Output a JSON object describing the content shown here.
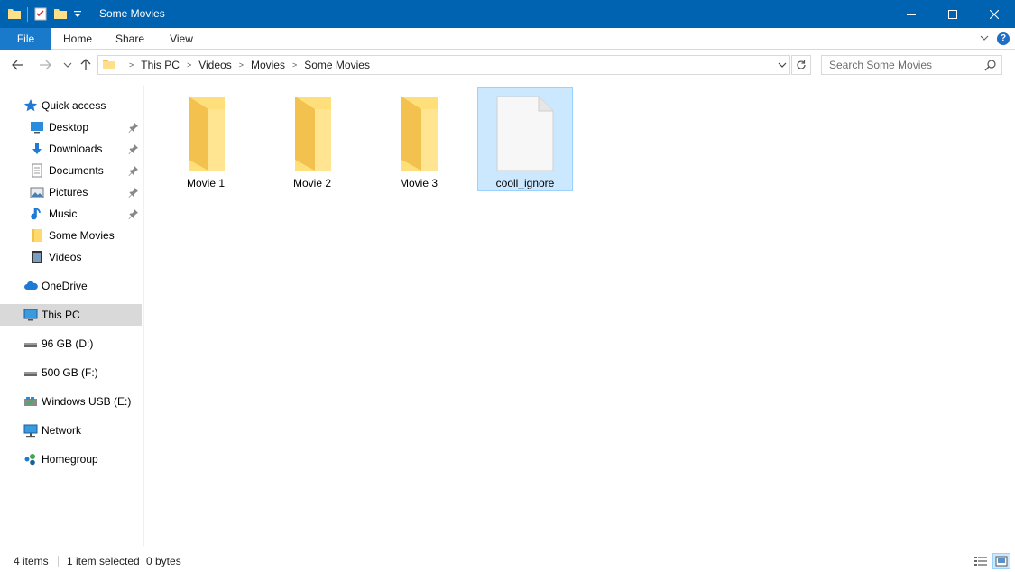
{
  "window": {
    "title": "Some Movies",
    "accent_color": "#0063b1",
    "controls": {
      "minimize": "—",
      "maximize": "☐",
      "close": "✕"
    }
  },
  "ribbon": {
    "tabs": [
      {
        "label": "File"
      },
      {
        "label": "Home"
      },
      {
        "label": "Share"
      },
      {
        "label": "View"
      }
    ],
    "help": "?"
  },
  "address_bar": {
    "crumbs": [
      "This PC",
      "Videos",
      "Movies",
      "Some Movies"
    ]
  },
  "search": {
    "placeholder": "Search Some Movies"
  },
  "navigation_pane": {
    "quick_access": "Quick access",
    "quick_items": [
      {
        "label": "Desktop",
        "icon": "desktop-icon"
      },
      {
        "label": "Downloads",
        "icon": "downloads-icon"
      },
      {
        "label": "Documents",
        "icon": "documents-icon"
      },
      {
        "label": "Pictures",
        "icon": "pictures-icon"
      },
      {
        "label": "Music",
        "icon": "music-icon"
      },
      {
        "label": "Some Movies",
        "icon": "folder-icon"
      },
      {
        "label": "Videos",
        "icon": "videos-icon"
      }
    ],
    "onedrive": "OneDrive",
    "this_pc": "This PC",
    "drives": [
      {
        "label": "96 GB (D:)"
      },
      {
        "label": "500 GB (F:)"
      },
      {
        "label": "Windows USB (E:)"
      }
    ],
    "network": "Network",
    "homegroup": "Homegroup"
  },
  "content": {
    "items": [
      {
        "name": "Movie 1",
        "type": "folder"
      },
      {
        "name": "Movie 2",
        "type": "folder"
      },
      {
        "name": "Movie 3",
        "type": "folder"
      },
      {
        "name": "cooll_ignore",
        "type": "file",
        "selected": true
      }
    ]
  },
  "status_bar": {
    "count": "4 items",
    "selection": "1 item selected",
    "size": "0 bytes"
  }
}
